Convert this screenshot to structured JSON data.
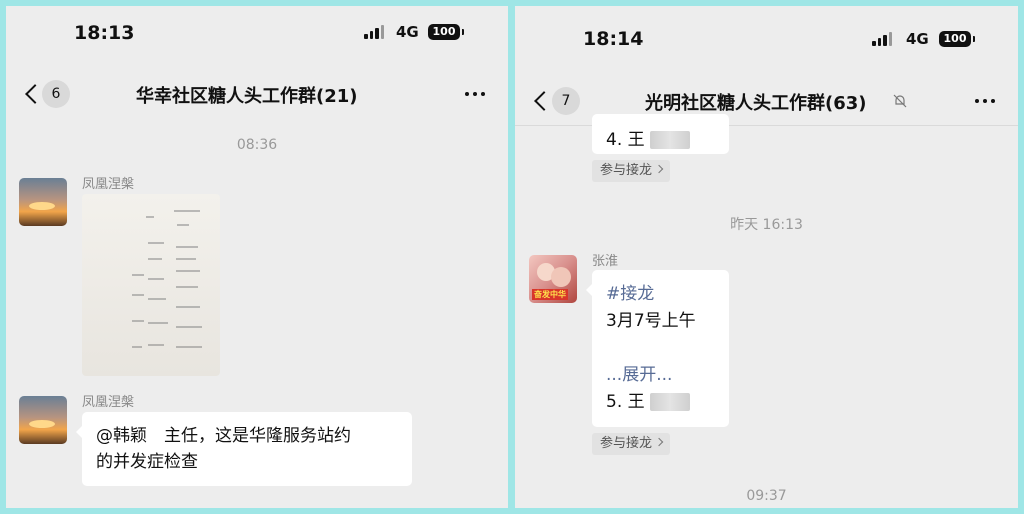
{
  "left": {
    "status": {
      "time": "18:13",
      "network": "4G",
      "battery": "100"
    },
    "nav": {
      "unread": "6",
      "title": "华幸社区糖人头工作群(21)"
    },
    "timestamp": "08:36",
    "messages": [
      {
        "sender": "凤凰涅槃",
        "type": "image"
      },
      {
        "sender": "凤凰涅槃",
        "line1": "@韩颖　主任，这是华隆服务站约",
        "line2": "的并发症检查"
      }
    ]
  },
  "right": {
    "status": {
      "time": "18:14",
      "network": "4G",
      "battery": "100"
    },
    "nav": {
      "unread": "7",
      "title": "光明社区糖人头工作群(63)"
    },
    "partial": {
      "text": "4. 王"
    },
    "join_label": "参与接龙",
    "timestamp1": "昨天 16:13",
    "message": {
      "sender": "张淮",
      "avatar_tag": "奋发中华",
      "hashtag": "#接龙",
      "line": "3月7号上午",
      "expand": "...展开...",
      "item": "5. 王"
    },
    "timestamp2": "09:37"
  },
  "colors": {
    "frame": "#9fe6e6",
    "chat_bg": "#ededed",
    "link": "#576b95"
  }
}
